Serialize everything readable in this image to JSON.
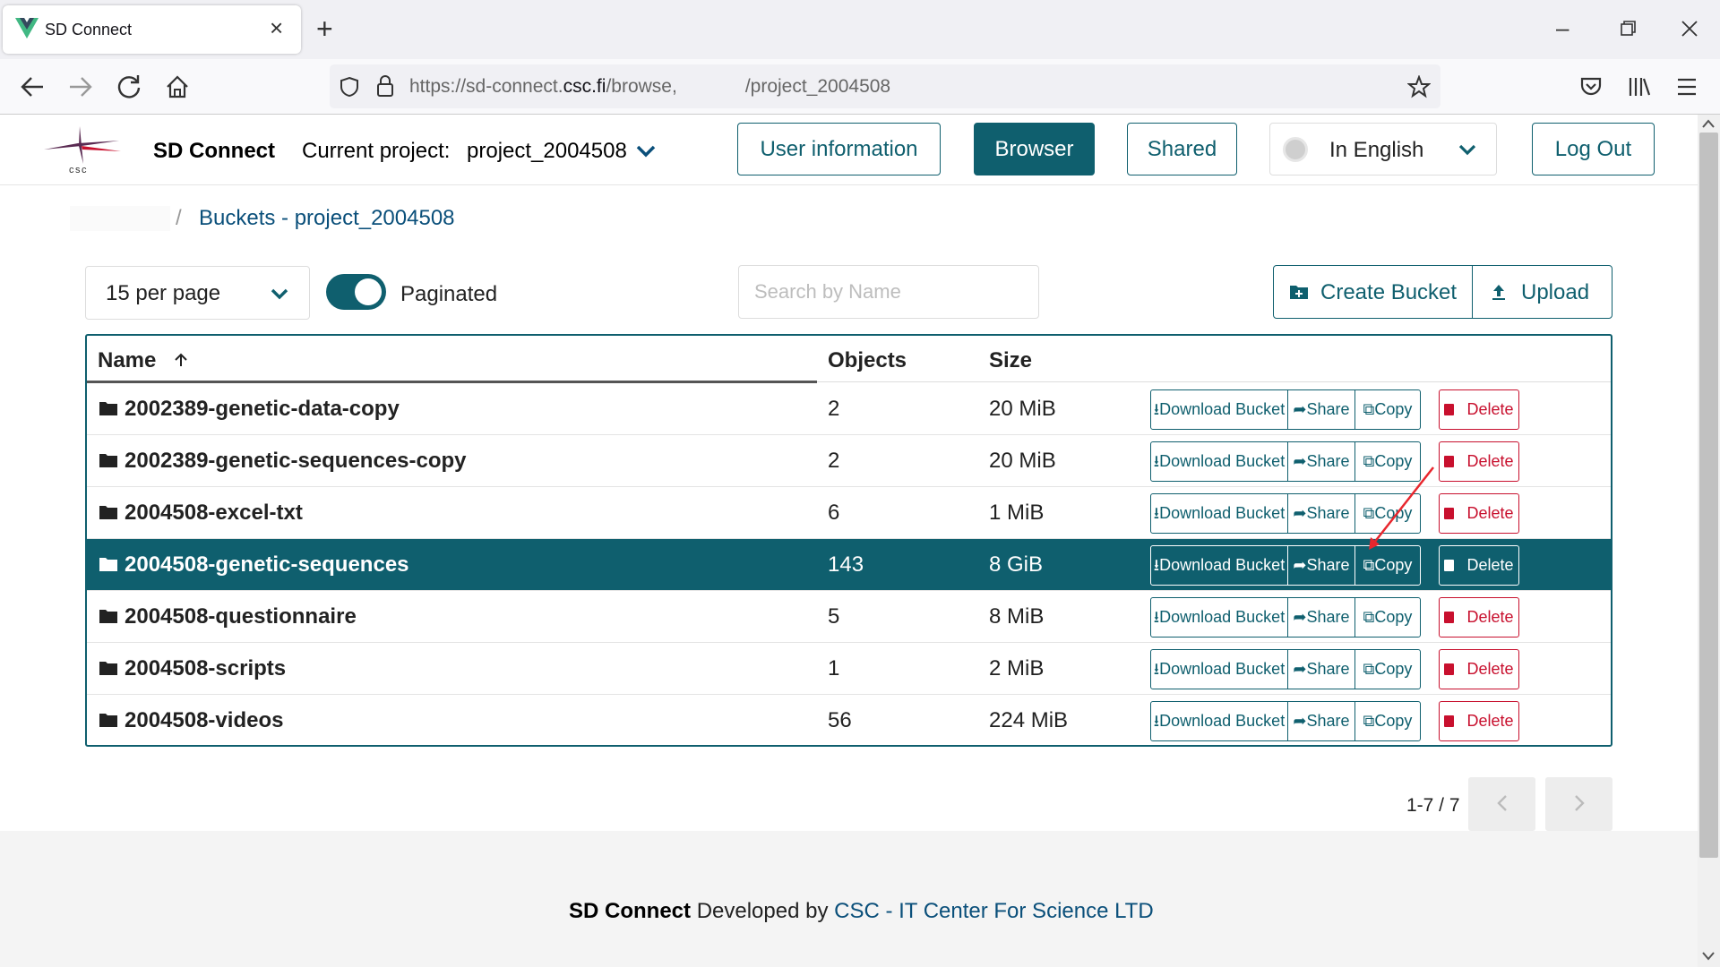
{
  "browser": {
    "tab_title": "SD Connect",
    "url_prefix": "https://sd-connect.",
    "url_domain": "csc.fi",
    "url_path": "/browse,",
    "url_tail": "/project_2004508"
  },
  "header": {
    "app_name": "SD Connect",
    "project_label": "Current project:",
    "project_name": "project_2004508",
    "nav": {
      "user_info": "User information",
      "browser": "Browser",
      "shared": "Shared",
      "language": "In English",
      "logout": "Log Out"
    }
  },
  "breadcrumb": {
    "current": "Buckets - project_2004508"
  },
  "controls": {
    "per_page": "15 per page",
    "paginated_label": "Paginated",
    "paginated_on": true,
    "search_placeholder": "Search by Name",
    "create_bucket": "Create Bucket",
    "upload": "Upload"
  },
  "table": {
    "columns": {
      "name": "Name",
      "objects": "Objects",
      "size": "Size"
    },
    "sort_icon": "arrow-up-icon",
    "action_labels": {
      "download": "Download Bucket",
      "share": "Share",
      "copy": "Copy",
      "delete": "Delete"
    },
    "rows": [
      {
        "name": "2002389-genetic-data-copy",
        "objects": "2",
        "size": "20 MiB",
        "selected": false
      },
      {
        "name": "2002389-genetic-sequences-copy",
        "objects": "2",
        "size": "20 MiB",
        "selected": false
      },
      {
        "name": "2004508-excel-txt",
        "objects": "6",
        "size": "1 MiB",
        "selected": false
      },
      {
        "name": "2004508-genetic-sequences",
        "objects": "143",
        "size": "8 GiB",
        "selected": true
      },
      {
        "name": "2004508-questionnaire",
        "objects": "5",
        "size": "8 MiB",
        "selected": false
      },
      {
        "name": "2004508-scripts",
        "objects": "1",
        "size": "2 MiB",
        "selected": false
      },
      {
        "name": "2004508-videos",
        "objects": "56",
        "size": "224 MiB",
        "selected": false
      }
    ]
  },
  "pagination": {
    "count": "1-7 / 7"
  },
  "footer": {
    "app_name": "SD Connect",
    "developed_by": "Developed by",
    "org": "CSC - IT Center For Science LTD"
  },
  "colors": {
    "accent": "#0f5f6e",
    "danger": "#c8102e",
    "link": "#0a4f7a"
  }
}
